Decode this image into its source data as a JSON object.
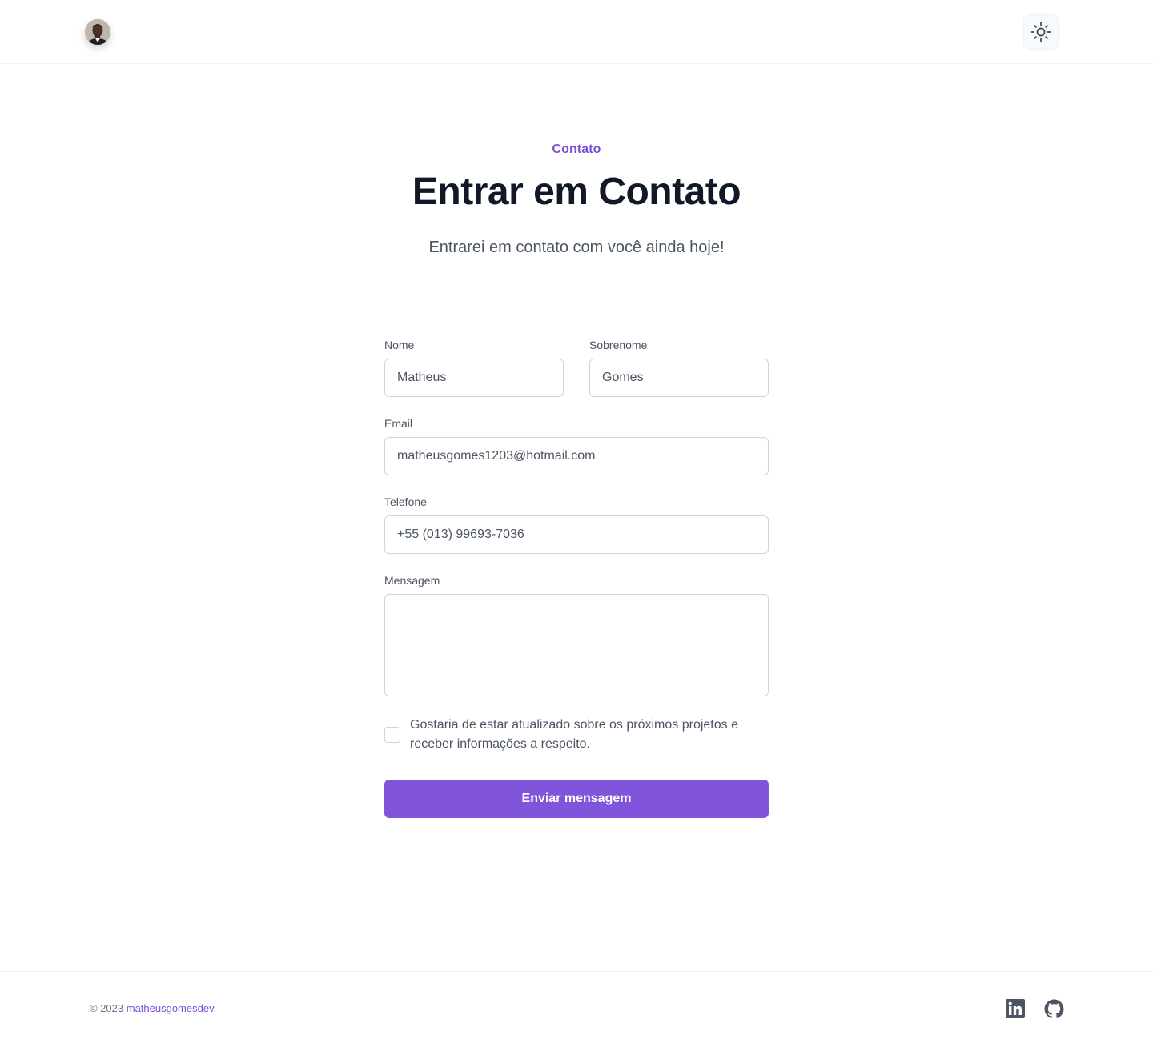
{
  "header": {
    "theme_toggle_icon": "sun-icon"
  },
  "hero": {
    "eyebrow": "Contato",
    "title": "Entrar em Contato",
    "subtitle": "Entrarei em contato com você ainda hoje!"
  },
  "form": {
    "first_name": {
      "label": "Nome",
      "value": "Matheus"
    },
    "last_name": {
      "label": "Sobrenome",
      "value": "Gomes"
    },
    "email": {
      "label": "Email",
      "value": "matheusgomes1203@hotmail.com"
    },
    "phone": {
      "label": "Telefone",
      "value": "+55 (013) 99693-7036"
    },
    "message": {
      "label": "Mensagem",
      "value": ""
    },
    "newsletter_checkbox": {
      "checked": false,
      "label": "Gostaria de estar atualizado sobre os próximos projetos e receber informações a respeito."
    },
    "submit_label": "Enviar mensagem"
  },
  "footer": {
    "copyright_prefix": "© 2023 ",
    "brand_link": "matheusgomesdev",
    "copyright_suffix": ".",
    "social": [
      "linkedin-icon",
      "github-icon"
    ]
  },
  "colors": {
    "accent": "#8054db",
    "accent_text": "#7c4fd9",
    "heading": "#111827",
    "body_text": "#4b5563"
  }
}
